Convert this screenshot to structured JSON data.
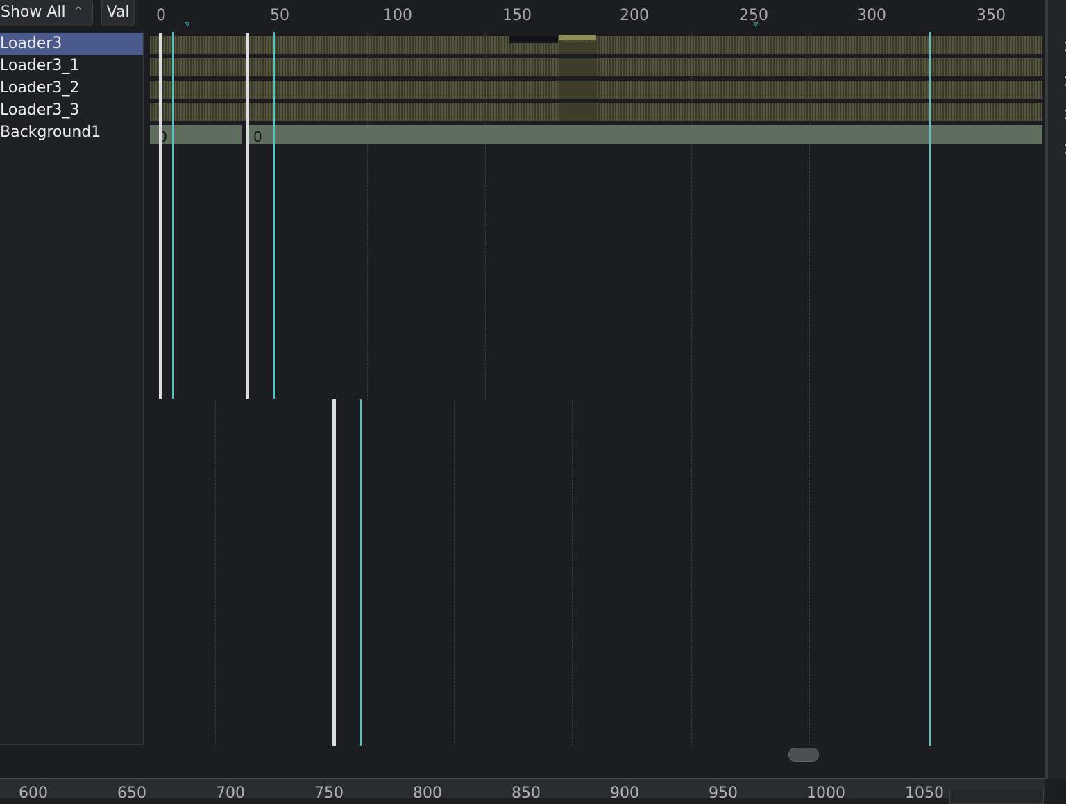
{
  "toolbar": {
    "filter_label": "Show All",
    "filter_chevron": "^",
    "value_button": "Val"
  },
  "tracks": [
    {
      "label": "Loader3",
      "selected": true
    },
    {
      "label": "Loader3_1",
      "selected": false
    },
    {
      "label": "Loader3_2",
      "selected": false
    },
    {
      "label": "Loader3_3",
      "selected": false
    },
    {
      "label": "Background1",
      "selected": false
    }
  ],
  "ruler": {
    "ticks": [
      "0",
      "50",
      "100",
      "150",
      "200",
      "250",
      "300",
      "350"
    ],
    "marker_glyph": "▿"
  },
  "background_labels": [
    "0",
    "0"
  ],
  "right_panel": {
    "expand_glyph": ">"
  },
  "bottom_ruler": {
    "ticks": [
      "600",
      "650",
      "700",
      "750",
      "800",
      "850",
      "900",
      "950",
      "1000",
      "1050"
    ]
  },
  "colors": {
    "selection": "#4a5a8c",
    "playhead": "#48c7c7",
    "keyframe_track": "#55553d",
    "background_track": "#5f6d5f"
  }
}
